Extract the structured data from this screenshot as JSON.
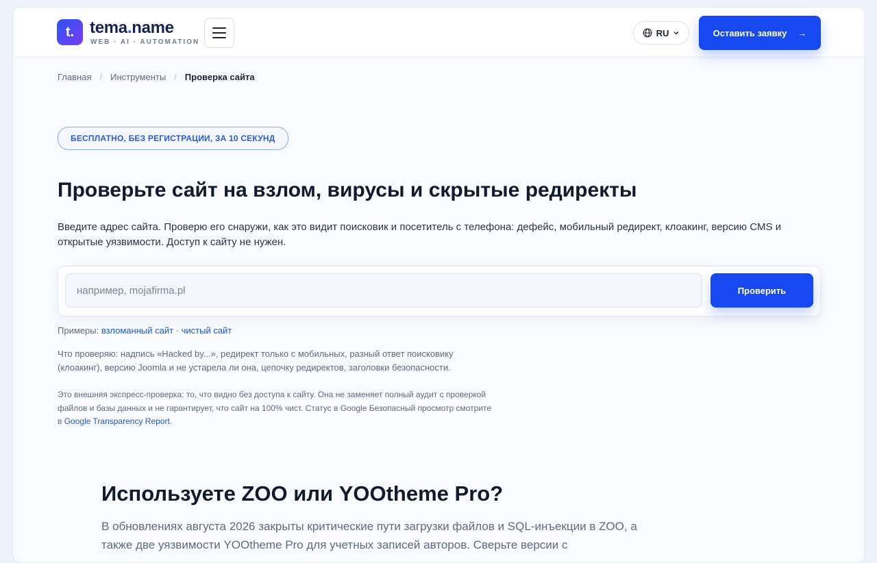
{
  "header": {
    "logo_letter": "t.",
    "brand_name": "tema",
    "brand_dot": ".",
    "brand_tld": "name",
    "tagline": "WEB · AI · AUTOMATION",
    "language": "RU",
    "cta_label": "Оставить заявку",
    "cta_arrow": "→"
  },
  "breadcrumb": {
    "items": [
      "Главная",
      "Инструменты",
      "Проверка сайта"
    ],
    "separator": "/"
  },
  "hero": {
    "badge": "БЕСПЛАТНО, БЕЗ РЕГИСТРАЦИИ, ЗА 10 СЕКУНД",
    "title": "Проверьте сайт на взлом, вирусы и скрытые редиректы",
    "lead": "Введите адрес сайта. Проверю его снаружи, как это видит поисковик и посетитель с телефона: дефейс, мобильный редирект, клоакинг, версию CMS и открытые уязвимости. Доступ к сайту не нужен."
  },
  "search": {
    "value": "",
    "placeholder": "например, mojafirma.pl",
    "button_label": "Проверить"
  },
  "examples": {
    "label": "Примеры:",
    "link1": "взломанный сайт",
    "separator": " · ",
    "link2": "чистый сайт"
  },
  "info": {
    "what_we_check": "Что проверяю: надпись «Hacked by...», редирект только с мобильных, разный ответ поисковику (клоакинг), версию Joomla и не устарела ли она, цепочку редиректов, заголовки безопасности.",
    "disclaimer_text": "Это внешняя экспресс-проверка: то, что видно без доступа к сайту. Она не заменяет полный аудит с проверкой файлов и базы данных и не гарантирует, что сайт на 100% чист. Статус в Google Безопасный просмотр смотрите в ",
    "disclaimer_link": "Google Transparency Report",
    "disclaimer_end": "."
  },
  "section": {
    "title": "Используете ZOO или YOOtheme Pro?",
    "text": "В обновлениях августа 2026 закрыты критические пути загрузки файлов и SQL-инъекции в ZOO, а также две уязвимости YOOtheme Pro для учетных записей авторов. Сверьте версии с"
  },
  "colors": {
    "accent": "#1649f0",
    "link": "#1d57c9",
    "background": "#f9fbfe"
  }
}
